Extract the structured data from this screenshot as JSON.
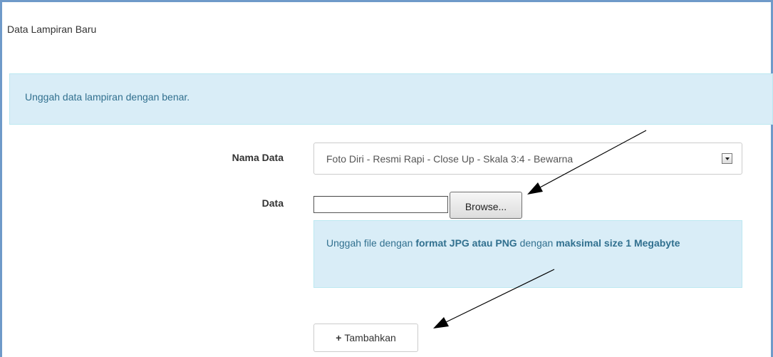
{
  "panel": {
    "title": "Data Lampiran Baru"
  },
  "alert": {
    "message": "Unggah data lampiran dengan benar."
  },
  "form": {
    "nama_data_label": "Nama Data",
    "nama_data_selected": "Foto Diri - Resmi Rapi - Close Up - Skala 3:4 - Bewarna",
    "data_label": "Data",
    "file_value": "",
    "browse_label": "Browse...",
    "help": {
      "t1": "Unggah file dengan ",
      "b1": "format JPG atau PNG",
      "t2": " dengan ",
      "b2": "maksimal size 1 Megabyte"
    },
    "add_icon": "+",
    "add_label": "Tambahkan"
  },
  "colors": {
    "info_bg": "#d9edf7",
    "info_text": "#31708f",
    "frame_border": "#6f9ac9"
  },
  "icons": {
    "add": "plus-icon",
    "select": "chevron-down-icon"
  }
}
